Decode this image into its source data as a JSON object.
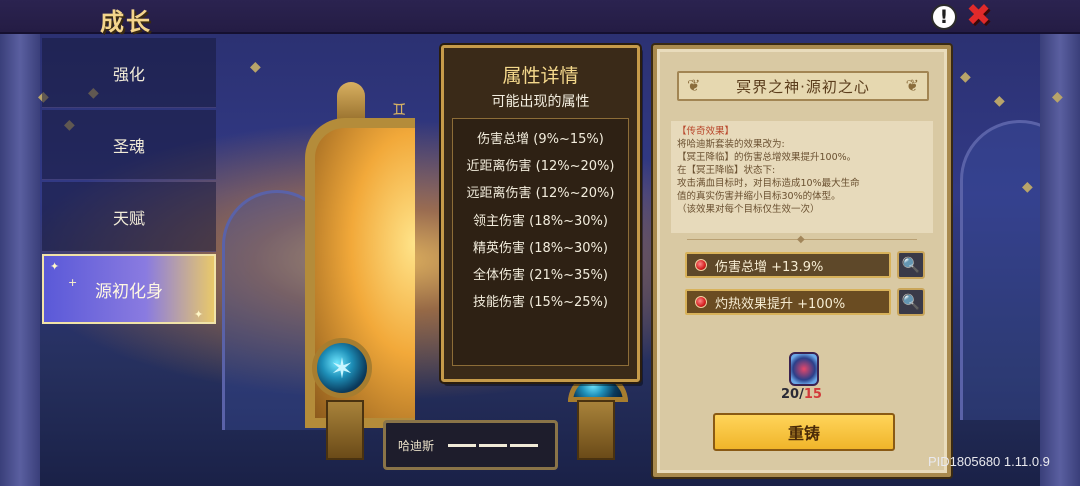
{
  "header": {
    "title": "成长",
    "help_icon": "exclamation-help-icon",
    "close_icon": "close-x-icon"
  },
  "menu": {
    "items": [
      {
        "label": "强化",
        "active": false
      },
      {
        "label": "圣魂",
        "active": false
      },
      {
        "label": "天赋",
        "active": false
      },
      {
        "label": "源初化身",
        "active": true
      }
    ]
  },
  "scene": {
    "nameplate_name": "哈迪斯"
  },
  "popup": {
    "title": "属性详情",
    "subtitle": "可能出现的属性",
    "rows": [
      "伤害总增 (9%~15%)",
      "近距离伤害 (12%~20%)",
      "远距离伤害 (12%~20%)",
      "领主伤害 (18%~30%)",
      "精英伤害 (18%~30%)",
      "全体伤害 (21%~35%)",
      "技能伤害 (15%~25%)"
    ]
  },
  "detail": {
    "title": "冥界之神·源初之心",
    "effect_lines": [
      "【传奇效果】",
      "将哈迪斯套装的效果改为:",
      "【冥王降临】的伤害总增效果提升100%。",
      "在【冥王降临】状态下:",
      "攻击满血目标时，对目标造成10%最大生命",
      "值的真实伤害并缩小目标30%的体型。",
      "（该效果对每个目标仅生效一次）"
    ],
    "stats": [
      {
        "text": "伤害总增 +13.9%"
      },
      {
        "text": "灼热效果提升 +100%"
      }
    ],
    "counter_current": "20",
    "counter_sep": "/",
    "counter_max": "15",
    "reforge_label": "重铸"
  },
  "footer": {
    "version": "PID1805680 1.11.0.9"
  },
  "colors": {
    "accent_gold": "#c69b4a",
    "menu_active": "#6a64dc",
    "close_red": "#e02a2a",
    "button_yellow": "#ffd45a"
  }
}
